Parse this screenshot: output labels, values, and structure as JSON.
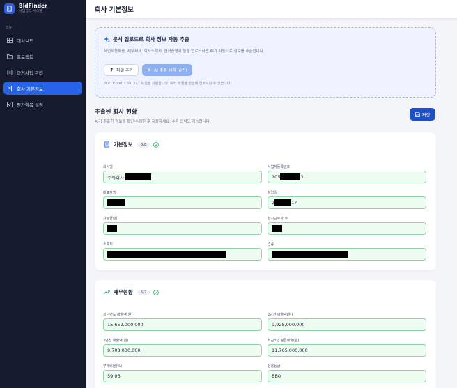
{
  "brand": {
    "title": "BidFinder",
    "subtitle": "사업협력 시스템"
  },
  "menu_label": "메뉴",
  "nav": [
    {
      "label": "대시보드",
      "icon": "grid-icon"
    },
    {
      "label": "프로젝트",
      "icon": "folder-icon"
    },
    {
      "label": "과거사업 관리",
      "icon": "document-icon"
    },
    {
      "label": "회사 기본정보",
      "icon": "building-icon"
    },
    {
      "label": "평가항목 설정",
      "icon": "checklist-icon"
    }
  ],
  "active_nav": 3,
  "page_title": "회사 기본정보",
  "upload": {
    "title": "문서 업로드로 회사 정보 자동 추출",
    "description": "사업자등록증, 재무제표, 회사소개서, 연혁증명서 등을 업로드하면 AI가 자동으로 정보를 추출합니다.",
    "file_button": "파일 추가",
    "ai_button": "AI 추출 시작 (0건)",
    "hint": "PDF, Excel, CSV, TXT 파일을 지원합니다. 여러 파일을 한번에 업로드할 수 있습니다."
  },
  "extracted": {
    "title": "추출된 회사 현황",
    "subtitle": "AI가 추출한 정보를 확인/수정한 후 저장하세요. 수동 입력도 가능합니다.",
    "save_button": "저장"
  },
  "basic_card": {
    "title": "기본정보",
    "count": "8/8",
    "fields": [
      {
        "label": "회사명",
        "value": "주식회사"
      },
      {
        "label": "사업자등록번호",
        "value": "105",
        "value_suffix": "3"
      },
      {
        "label": "대표자명",
        "value": ""
      },
      {
        "label": "설립일",
        "value": "2",
        "value_suffix": "17"
      },
      {
        "label": "자본금(원)",
        "value": ""
      },
      {
        "label": "상시근로자 수",
        "value": ""
      },
      {
        "label": "소재지",
        "value": ""
      },
      {
        "label": "업종",
        "value": ""
      }
    ]
  },
  "finance_card": {
    "title": "재무현황",
    "count": "6/7",
    "fields": [
      {
        "label": "최근년도 매출액(원)",
        "value": "15,659,000,000"
      },
      {
        "label": "2년전 매출액(원)",
        "value": "9,928,000,000"
      },
      {
        "label": "3년전 매출액(원)",
        "value": "9,708,000,000"
      },
      {
        "label": "최근3년 평균매출(원)",
        "value": "11,765,000,000"
      },
      {
        "label": "부채비율(%)",
        "value": "59.06"
      },
      {
        "label": "신용등급",
        "value": "BB0"
      }
    ]
  },
  "colors": {
    "sidebar": "#161b2e",
    "accent": "#2563eb",
    "field_border": "#8fd6a6",
    "field_bg": "#eefcf2"
  }
}
